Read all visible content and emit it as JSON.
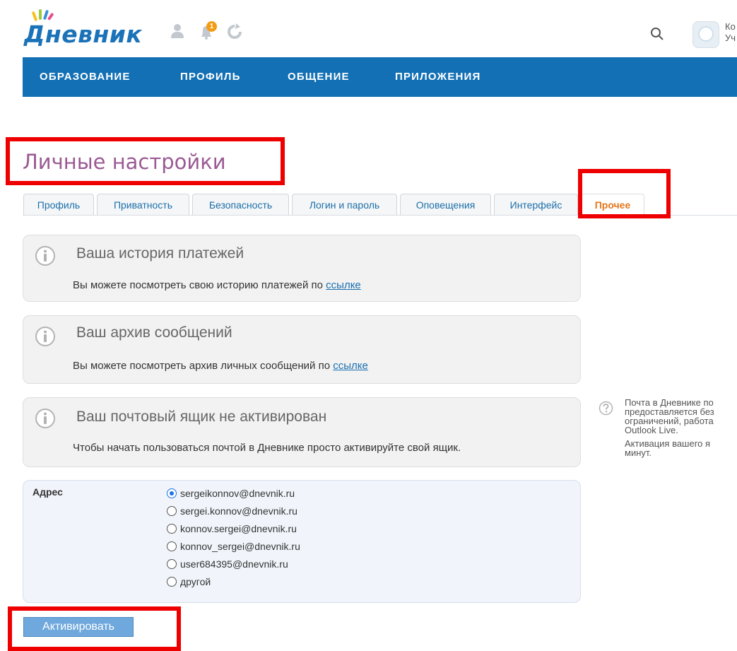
{
  "header": {
    "logo_text": "Дневник",
    "notifications_count": "1",
    "user_name_line1": "Ко",
    "user_name_line2": "Уч"
  },
  "topnav": {
    "items": [
      "ОБРАЗОВАНИЕ",
      "ПРОФИЛЬ",
      "ОБЩЕНИЕ",
      "ПРИЛОЖЕНИЯ"
    ]
  },
  "page": {
    "title": "Личные настройки"
  },
  "tabs": [
    {
      "label": "Профиль"
    },
    {
      "label": "Приватность"
    },
    {
      "label": "Безопасность"
    },
    {
      "label": "Логин и пароль"
    },
    {
      "label": "Оповещения"
    },
    {
      "label": "Интерфейс"
    },
    {
      "label": "Прочее",
      "active": true
    }
  ],
  "info_boxes": [
    {
      "title": "Ваша история платежей",
      "text": "Вы можете посмотреть свою историю платежей по ",
      "link": "ссылке"
    },
    {
      "title": "Ваш архив сообщений",
      "text": "Вы можете посмотреть архив личных сообщений по ",
      "link": "ссылке"
    },
    {
      "title": "Ваш почтовый ящик не активирован",
      "text": "Чтобы начать пользоваться почтой в Дневнике просто активируйте свой ящик."
    }
  ],
  "help": {
    "line1": "Почта в Дневнике по",
    "line2": "предоставляется без",
    "line3": "ограничений, работа",
    "line4": "Outlook Live.",
    "line5": "Активация вашего я",
    "line6": "минут."
  },
  "address": {
    "label": "Адрес",
    "options": [
      {
        "value": "sergeikonnov@dnevnik.ru",
        "selected": true
      },
      {
        "value": "sergei.konnov@dnevnik.ru"
      },
      {
        "value": "konnov.sergei@dnevnik.ru"
      },
      {
        "value": "konnov_sergei@dnevnik.ru"
      },
      {
        "value": "user684395@dnevnik.ru"
      },
      {
        "value": "другой"
      }
    ]
  },
  "actions": {
    "activate_label": "Активировать"
  },
  "colors": {
    "brand_blue": "#1370b5",
    "title_purple": "#9a5a94",
    "active_tab_orange": "#e4771c",
    "highlight_red": "#ee0000"
  }
}
